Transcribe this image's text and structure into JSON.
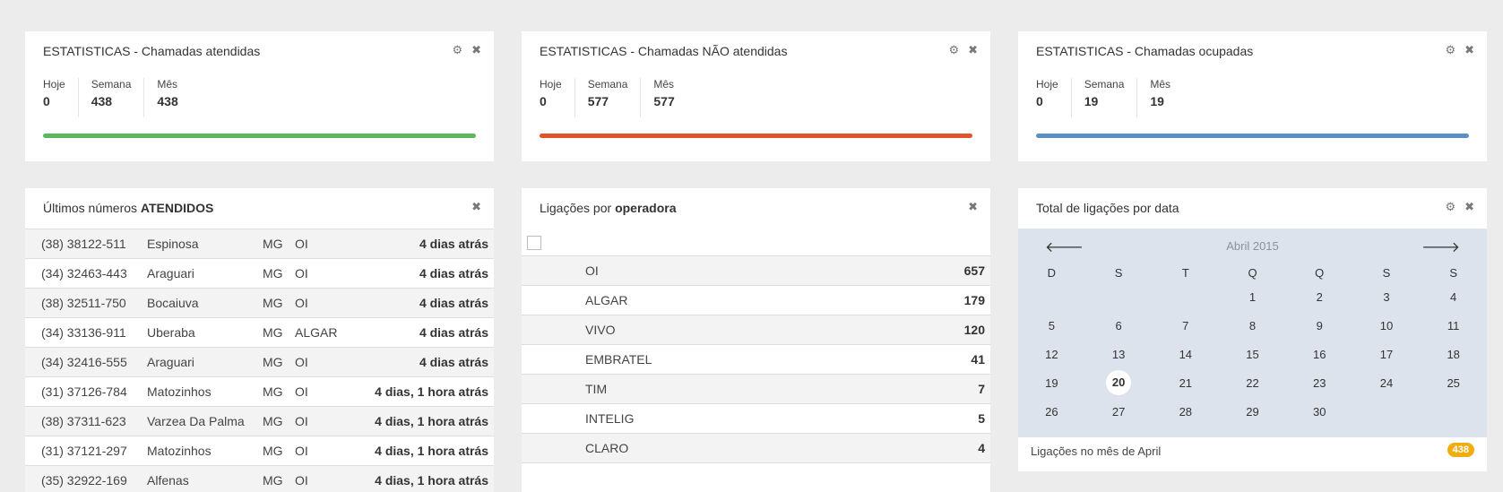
{
  "colors": {
    "green": "#5cb85c",
    "red": "#e1532a",
    "blue": "#5b8fc3",
    "badge": "#f0ad10"
  },
  "stats_widgets": [
    {
      "title": "ESTATISTICAS - Chamadas atendidas",
      "hoje_label": "Hoje",
      "hoje": "0",
      "semana_label": "Semana",
      "semana": "438",
      "mes_label": "Mês",
      "mes": "438"
    },
    {
      "title": "ESTATISTICAS - Chamadas NÃO atendidas",
      "hoje_label": "Hoje",
      "hoje": "0",
      "semana_label": "Semana",
      "semana": "577",
      "mes_label": "Mês",
      "mes": "577"
    },
    {
      "title": "ESTATISTICAS - Chamadas ocupadas",
      "hoje_label": "Hoje",
      "hoje": "0",
      "semana_label": "Semana",
      "semana": "19",
      "mes_label": "Mês",
      "mes": "19"
    }
  ],
  "icons": {
    "settings": "gear-icon",
    "close": "close-icon"
  },
  "glyphs": {
    "gear": "⚙",
    "close": "✖",
    "prev": "🡐",
    "next": "🡒"
  },
  "ultimos": {
    "title_prefix": "Últimos números ",
    "title_bold": "ATENDIDOS",
    "rows": [
      {
        "numero": "(38) 38122-511",
        "cidade": "Espinosa",
        "uf": "MG",
        "operadora": "OI",
        "tempo": "4 dias atrás"
      },
      {
        "numero": "(34) 32463-443",
        "cidade": "Araguari",
        "uf": "MG",
        "operadora": "OI",
        "tempo": "4 dias atrás"
      },
      {
        "numero": "(38) 32511-750",
        "cidade": "Bocaiuva",
        "uf": "MG",
        "operadora": "OI",
        "tempo": "4 dias atrás"
      },
      {
        "numero": "(34) 33136-911",
        "cidade": "Uberaba",
        "uf": "MG",
        "operadora": "ALGAR",
        "tempo": "4 dias atrás"
      },
      {
        "numero": "(34) 32416-555",
        "cidade": "Araguari",
        "uf": "MG",
        "operadora": "OI",
        "tempo": "4 dias atrás"
      },
      {
        "numero": "(31) 37126-784",
        "cidade": "Matozinhos",
        "uf": "MG",
        "operadora": "OI",
        "tempo": "4 dias, 1 hora atrás"
      },
      {
        "numero": "(38) 37311-623",
        "cidade": "Varzea Da Palma",
        "uf": "MG",
        "operadora": "OI",
        "tempo": "4 dias, 1 hora atrás"
      },
      {
        "numero": "(31) 37121-297",
        "cidade": "Matozinhos",
        "uf": "MG",
        "operadora": "OI",
        "tempo": "4 dias, 1 hora atrás"
      },
      {
        "numero": "(35) 32922-169",
        "cidade": "Alfenas",
        "uf": "MG",
        "operadora": "OI",
        "tempo": "4 dias, 1 hora atrás"
      }
    ]
  },
  "operadoras": {
    "title_prefix": "Ligações por ",
    "title_bold": "operadora",
    "rows": [
      {
        "nome": "OI",
        "total": "657"
      },
      {
        "nome": "ALGAR",
        "total": "179"
      },
      {
        "nome": "VIVO",
        "total": "120"
      },
      {
        "nome": "EMBRATEL",
        "total": "41"
      },
      {
        "nome": "TIM",
        "total": "7"
      },
      {
        "nome": "INTELIG",
        "total": "5"
      },
      {
        "nome": "CLARO",
        "total": "4"
      }
    ]
  },
  "calendario": {
    "title": "Total de ligações por data",
    "month": "Abril 2015",
    "weekdays": [
      "D",
      "S",
      "T",
      "Q",
      "Q",
      "S",
      "S"
    ],
    "weeks": [
      [
        "",
        "",
        "",
        "1",
        "2",
        "3",
        "4"
      ],
      [
        "5",
        "6",
        "7",
        "8",
        "9",
        "10",
        "11"
      ],
      [
        "12",
        "13",
        "14",
        "15",
        "16",
        "17",
        "18"
      ],
      [
        "19",
        "20",
        "21",
        "22",
        "23",
        "24",
        "25"
      ],
      [
        "26",
        "27",
        "28",
        "29",
        "30",
        "",
        ""
      ]
    ],
    "today": "20",
    "footer": "Ligações no mês de April",
    "badge": "438"
  }
}
